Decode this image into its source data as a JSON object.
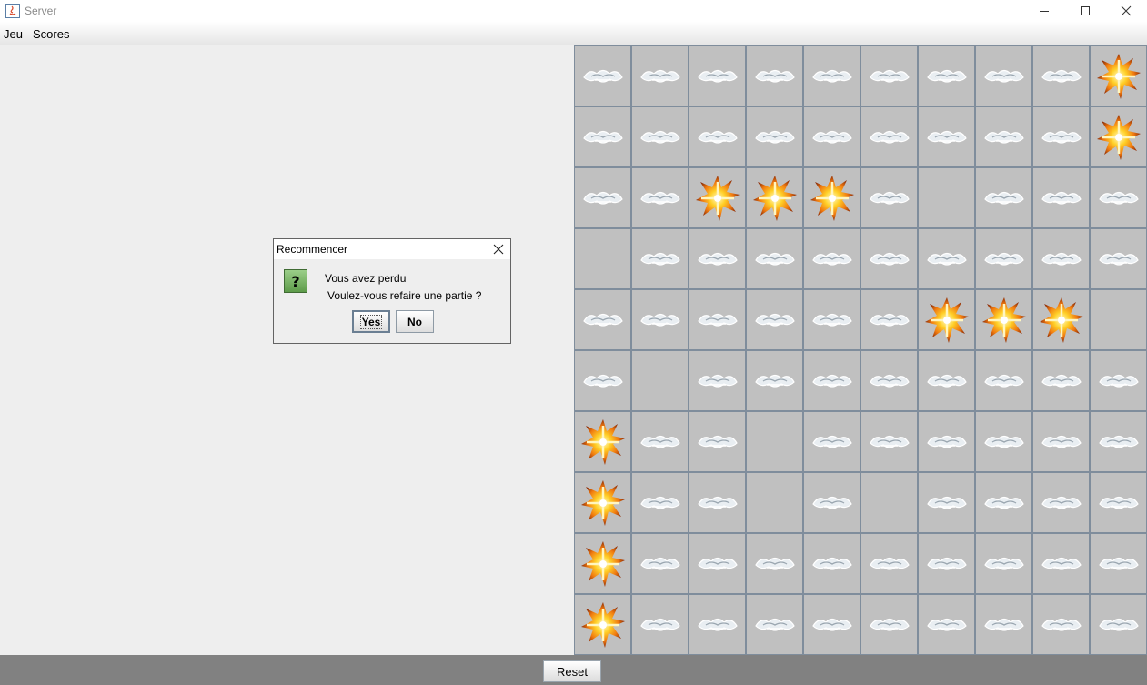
{
  "window": {
    "title": "Server",
    "icon": "java-app-icon"
  },
  "menu": {
    "items": [
      "Jeu",
      "Scores"
    ]
  },
  "board": {
    "rows": 10,
    "cols": 10,
    "cell_colors": {
      "background": "#c0c0c0",
      "border": "#7f8d9c"
    },
    "grid": [
      [
        "cloud",
        "cloud",
        "cloud",
        "cloud",
        "cloud",
        "cloud",
        "cloud",
        "cloud",
        "cloud",
        "explosion"
      ],
      [
        "cloud",
        "cloud",
        "cloud",
        "cloud",
        "cloud",
        "cloud",
        "cloud",
        "cloud",
        "cloud",
        "explosion"
      ],
      [
        "cloud",
        "cloud",
        "explosion",
        "explosion",
        "explosion",
        "cloud",
        "empty",
        "cloud",
        "cloud",
        "cloud"
      ],
      [
        "empty",
        "cloud",
        "cloud",
        "cloud",
        "cloud",
        "cloud",
        "cloud",
        "cloud",
        "cloud",
        "cloud"
      ],
      [
        "cloud",
        "cloud",
        "cloud",
        "cloud",
        "cloud",
        "cloud",
        "explosion",
        "explosion",
        "explosion",
        "empty"
      ],
      [
        "cloud",
        "empty",
        "cloud",
        "cloud",
        "cloud",
        "cloud",
        "cloud",
        "cloud",
        "cloud",
        "cloud"
      ],
      [
        "explosion",
        "cloud",
        "cloud",
        "empty",
        "cloud",
        "cloud",
        "cloud",
        "cloud",
        "cloud",
        "cloud"
      ],
      [
        "explosion",
        "cloud",
        "cloud",
        "empty",
        "cloud",
        "empty",
        "cloud",
        "cloud",
        "cloud",
        "cloud"
      ],
      [
        "explosion",
        "cloud",
        "cloud",
        "cloud",
        "cloud",
        "cloud",
        "cloud",
        "cloud",
        "cloud",
        "cloud"
      ],
      [
        "explosion",
        "cloud",
        "cloud",
        "cloud",
        "cloud",
        "cloud",
        "cloud",
        "cloud",
        "cloud",
        "cloud"
      ]
    ]
  },
  "bottom": {
    "reset_label": "Reset"
  },
  "dialog": {
    "title": "Recommencer",
    "icon": "question-icon",
    "message_line1": "Vous avez perdu",
    "message_line2": "Voulez-vous refaire une partie ?",
    "yes_label": "Yes",
    "no_label": "No"
  }
}
